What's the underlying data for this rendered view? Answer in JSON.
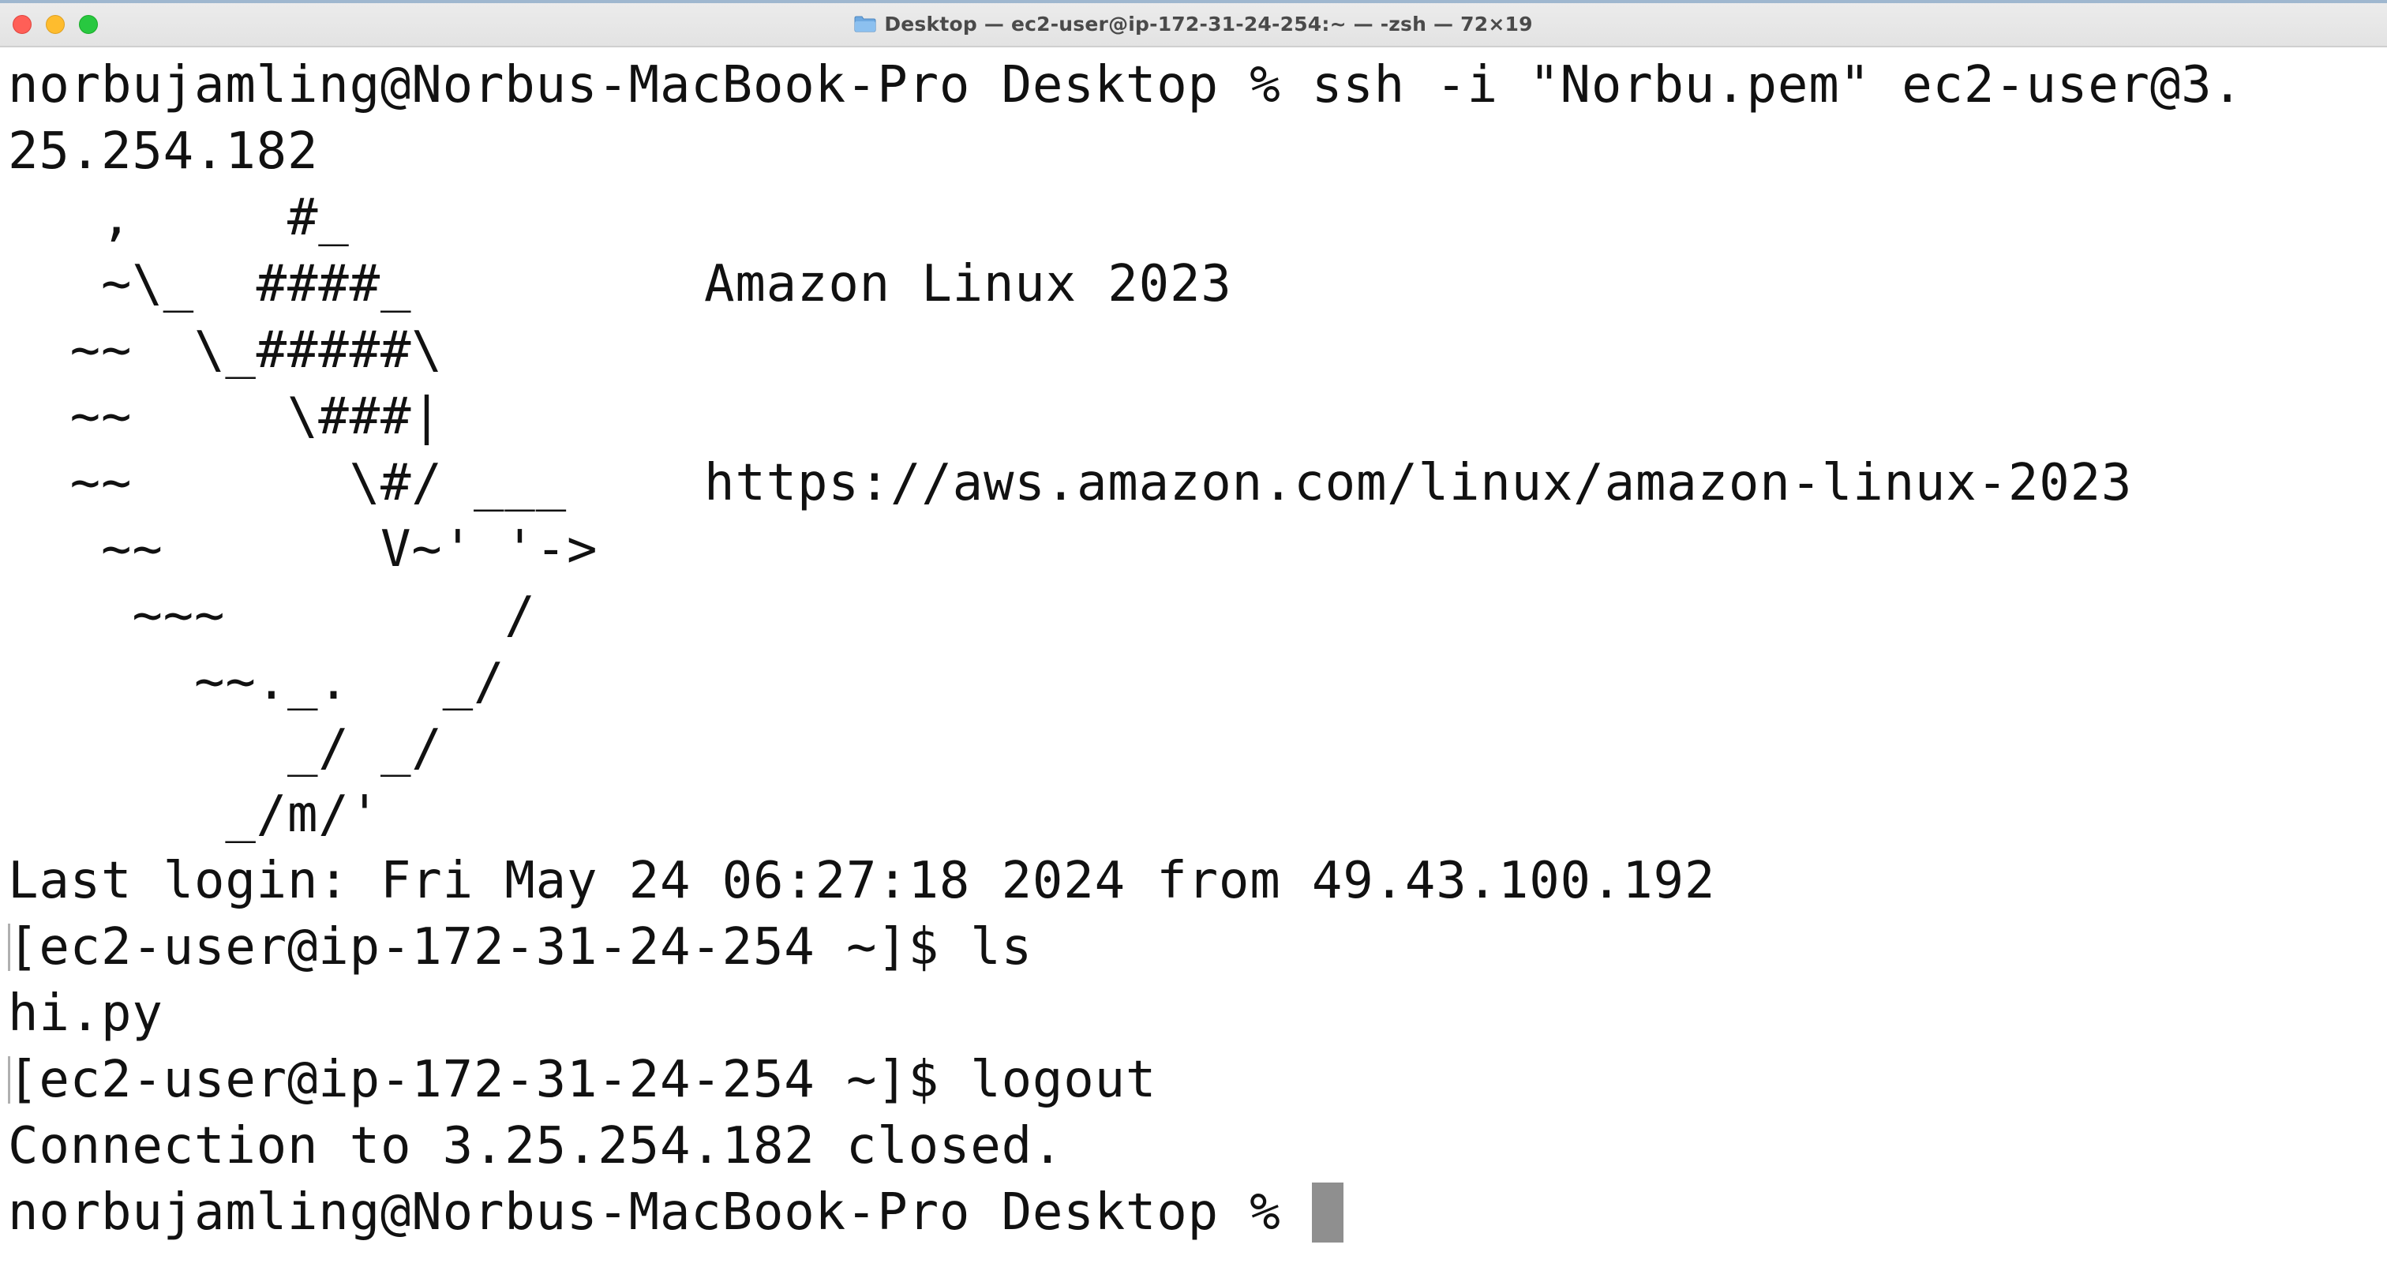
{
  "window": {
    "title": "Desktop — ec2-user@ip-172-31-24-254:~ — -zsh — 72×19",
    "title_icon": "folder-icon",
    "traffic_lights": {
      "close": "#ff5f57",
      "minimize": "#febc2e",
      "zoom": "#28c840"
    }
  },
  "terminal": {
    "lines": [
      {
        "text": "norbujamling@Norbus-MacBook-Pro Desktop % ssh -i \"Norbu.pem\" ec2-user@3."
      },
      {
        "text": "25.254.182"
      },
      {
        "art": "   ,     #_",
        "info": ""
      },
      {
        "art": "   ~\\_  ####_",
        "info": "Amazon Linux 2023"
      },
      {
        "art": "  ~~  \\_#####\\",
        "info": ""
      },
      {
        "art": "  ~~     \\###|",
        "info": ""
      },
      {
        "art": "  ~~       \\#/ ___",
        "info": "https://aws.amazon.com/linux/amazon-linux-2023"
      },
      {
        "art": "   ~~       V~' '->",
        "info": ""
      },
      {
        "art": "    ~~~         /",
        "info": ""
      },
      {
        "art": "      ~~._.   _/",
        "info": ""
      },
      {
        "art": "         _/ _/",
        "info": ""
      },
      {
        "art": "       _/m/'",
        "info": ""
      },
      {
        "text": "Last login: Fri May 24 06:27:18 2024 from 49.43.100.192"
      },
      {
        "text": "[ec2-user@ip-172-31-24-254 ~]$ ls"
      },
      {
        "text": "hi.py"
      },
      {
        "text": "[ec2-user@ip-172-31-24-254 ~]$ logout"
      },
      {
        "text": "Connection to 3.25.254.182 closed."
      },
      {
        "text": "norbujamling@Norbus-MacBook-Pro Desktop % "
      }
    ],
    "cursor_color": "#8f8f8f",
    "text_color": "#111111",
    "background": "#ffffff"
  }
}
